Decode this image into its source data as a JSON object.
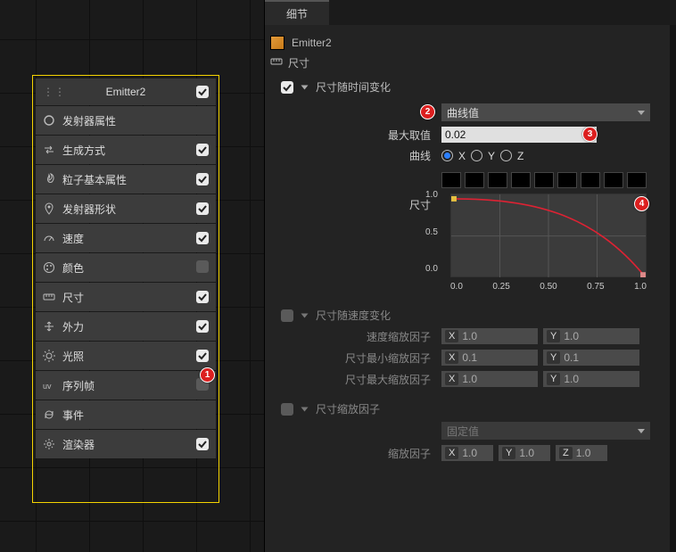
{
  "left": {
    "header": "Emitter2",
    "header_checked": true,
    "items": [
      {
        "icon": "circle",
        "label": "发射器属性",
        "chk": null
      },
      {
        "icon": "swap",
        "label": "生成方式",
        "chk": true
      },
      {
        "icon": "flame",
        "label": "粒子基本属性",
        "chk": true
      },
      {
        "icon": "pin",
        "label": "发射器形状",
        "chk": true
      },
      {
        "icon": "gauge",
        "label": "速度",
        "chk": true
      },
      {
        "icon": "palette",
        "label": "颜色",
        "chk": false
      },
      {
        "icon": "ruler",
        "label": "尺寸",
        "chk": true
      },
      {
        "icon": "arrows",
        "label": "外力",
        "chk": true
      },
      {
        "icon": "sun",
        "label": "光照",
        "chk": true
      },
      {
        "icon": "uv",
        "label": "序列帧",
        "chk": false
      },
      {
        "icon": "cycle",
        "label": "事件",
        "chk": null
      },
      {
        "icon": "gear",
        "label": "渲染器",
        "chk": true
      }
    ]
  },
  "right": {
    "tab": "细节",
    "title": "Emitter2",
    "section_title": "尺寸",
    "size_over_time": {
      "checked": true,
      "header": "尺寸随时间变化",
      "mode_label_options": "曲线值",
      "max_label": "最大取值",
      "max_value": "0.02",
      "curve_label": "曲线",
      "radios": {
        "x": true,
        "y": false,
        "z": false
      },
      "axis_labels": {
        "x": "X",
        "y": "Y",
        "z": "Z"
      },
      "chart_title": "尺寸",
      "y_ticks": [
        "1.0",
        "0.5",
        "0.0"
      ],
      "x_ticks": [
        "0.0",
        "0.25",
        "0.50",
        "0.75",
        "1.0"
      ]
    },
    "size_over_speed": {
      "checked": false,
      "header": "尺寸随速度变化",
      "rows": [
        {
          "label": "速度缩放因子",
          "x": "1.0",
          "y": "1.0"
        },
        {
          "label": "尺寸最小缩放因子",
          "x": "0.1",
          "y": "0.1"
        },
        {
          "label": "尺寸最大缩放因子",
          "x": "1.0",
          "y": "1.0"
        }
      ]
    },
    "size_scale": {
      "checked": false,
      "header": "尺寸缩放因子",
      "mode": "固定值",
      "row_label": "缩放因子",
      "x": "1.0",
      "y": "1.0",
      "z": "1.0"
    },
    "axes": {
      "x": "X",
      "y": "Y",
      "z": "Z"
    }
  },
  "chart_data": {
    "type": "line",
    "title": "尺寸",
    "xlabel": "",
    "ylabel": "",
    "xlim": [
      0,
      1
    ],
    "ylim": [
      0,
      1
    ],
    "x": [
      0.0,
      0.25,
      0.5,
      0.75,
      1.0
    ],
    "series": [
      {
        "name": "X",
        "values": [
          1.0,
          0.97,
          0.87,
          0.65,
          0.0
        ]
      }
    ]
  }
}
